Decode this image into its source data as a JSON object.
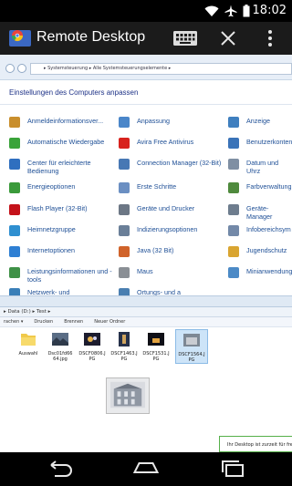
{
  "status_bar": {
    "time": "18:02",
    "icons": [
      "wifi-icon",
      "airplane-icon",
      "battery-icon"
    ]
  },
  "action_bar": {
    "title": "Remote Desktop",
    "app_icon": "chrome-remote-desktop-icon",
    "actions": [
      "keyboard-icon",
      "close-icon",
      "overflow-menu-icon"
    ]
  },
  "control_panel": {
    "breadcrumb": "▸ Systemsteuerung ▸ Alle Systemsteuerungselemente ▸",
    "title": "Einstellungen des Computers anpassen",
    "items": [
      {
        "label": "Anmeldeinformationsver...",
        "icon": "credential-manager-icon",
        "color": "#c98f2d"
      },
      {
        "label": "Anpassung",
        "icon": "personalization-icon",
        "color": "#4a86c9"
      },
      {
        "label": "Anzeige",
        "icon": "display-icon",
        "color": "#3f7fbf"
      },
      {
        "label": "Automatische Wiedergabe",
        "icon": "autoplay-icon",
        "color": "#3aa33a"
      },
      {
        "label": "Avira Free Antivirus",
        "icon": "avira-icon",
        "color": "#d8221d"
      },
      {
        "label": "Benutzerkonten",
        "icon": "user-accounts-icon",
        "color": "#3a73b8"
      },
      {
        "label": "Center für erleichterte Bedienung",
        "icon": "ease-of-access-icon",
        "color": "#2f6fbf"
      },
      {
        "label": "Connection Manager (32-Bit)",
        "icon": "connection-manager-icon",
        "color": "#4778b4"
      },
      {
        "label": "Datum und Uhrz",
        "icon": "date-time-icon",
        "color": "#7f8fa3"
      },
      {
        "label": "Energieoptionen",
        "icon": "power-options-icon",
        "color": "#3a9a3a"
      },
      {
        "label": "Erste Schritte",
        "icon": "getting-started-icon",
        "color": "#6b8fc2"
      },
      {
        "label": "Farbverwaltung",
        "icon": "color-management-icon",
        "color": "#4f8a3d"
      },
      {
        "label": "Flash Player (32-Bit)",
        "icon": "flash-player-icon",
        "color": "#c4121a"
      },
      {
        "label": "Geräte und Drucker",
        "icon": "devices-printers-icon",
        "color": "#6c7785"
      },
      {
        "label": "Geräte-Manager",
        "icon": "device-manager-icon",
        "color": "#6e7d8e"
      },
      {
        "label": "Heimnetzgruppe",
        "icon": "homegroup-icon",
        "color": "#2f8fd0"
      },
      {
        "label": "Indizierungsoptionen",
        "icon": "indexing-options-icon",
        "color": "#6a7f98"
      },
      {
        "label": "Infobereichsym",
        "icon": "notification-area-icon",
        "color": "#7389a8"
      },
      {
        "label": "Internetoptionen",
        "icon": "internet-options-icon",
        "color": "#2e7fd3"
      },
      {
        "label": "Java (32 Bit)",
        "icon": "java-icon",
        "color": "#d0632a"
      },
      {
        "label": "Jugendschutz",
        "icon": "parental-controls-icon",
        "color": "#d9a531"
      },
      {
        "label": "Leistungsinformationen und -tools",
        "icon": "performance-icon",
        "color": "#3f9147"
      },
      {
        "label": "Maus",
        "icon": "mouse-icon",
        "color": "#8a8f95"
      },
      {
        "label": "Minianwendung",
        "icon": "gadgets-icon",
        "color": "#4c8ac6"
      },
      {
        "label": "Netzwerk- und",
        "icon": "network-icon",
        "color": "#3a7fb8"
      },
      {
        "label": "Ortungs- und a",
        "icon": "location-icon",
        "color": "#4a7fb1"
      }
    ]
  },
  "explorer": {
    "breadcrumb": "▸ Data (D:) ▸ Test ▸",
    "toolbar": [
      "rachen ▾",
      "Drucken",
      "Brennen",
      "Neuer Ordner"
    ],
    "files": [
      {
        "name": "Auswahl",
        "type": "folder"
      },
      {
        "name": "Dsc01fd66\n64.jpg",
        "type": "image"
      },
      {
        "name": "DSCF0806.J\nPG",
        "type": "image"
      },
      {
        "name": "DSCF1463.J\nPG",
        "type": "image"
      },
      {
        "name": "DSCF1531.J\nPG",
        "type": "image"
      },
      {
        "name": "DSCF1564.J\nPG",
        "type": "image",
        "selected": true
      }
    ],
    "notice": "Ihr Desktop ist zurzeit für fre"
  },
  "nav_bar": {
    "buttons": [
      "back-icon",
      "home-icon",
      "recent-apps-icon"
    ]
  }
}
